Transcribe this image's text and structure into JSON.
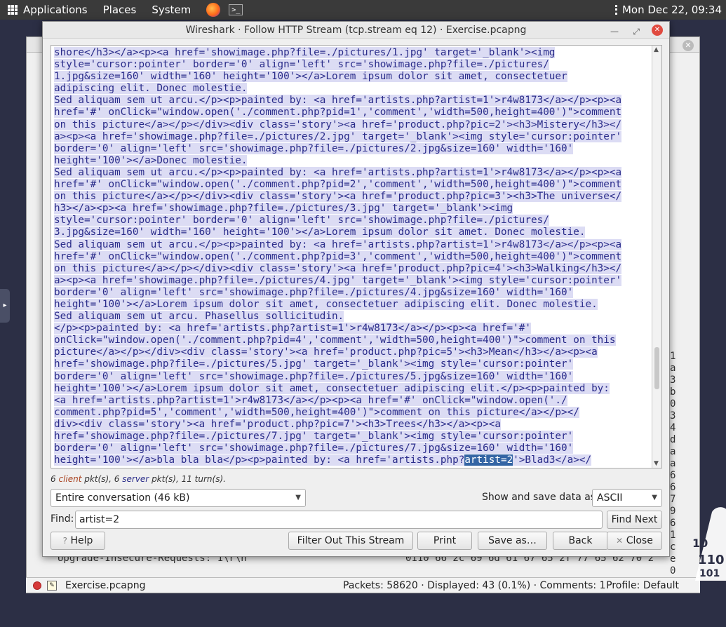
{
  "panel": {
    "applications": "Applications",
    "places": "Places",
    "system": "System",
    "clock": "Mon Dec 22, 09:34"
  },
  "main": {
    "file": "Exercise.pcapng",
    "packets": "Packets: 58620 · Displayed: 43 (0.1%) · Comments: 1",
    "profile": "Profile: Default",
    "bg_request": "Upgrade-Insecure-Requests: 1\\r\\n",
    "bg_bytes": "0110   66 2c 69 6d 61 67 65 2f   77 65 62 70 2"
  },
  "dialog": {
    "title": "Wireshark · Follow HTTP Stream (tcp.stream eq 12) · Exercise.pcapng",
    "stream_lines": [
      "shore</h3></a><p><a href='showimage.php?file=./pictures/1.jpg' target='_blank'><img",
      "style='cursor:pointer' border='0' align='left' src='showimage.php?file=./pictures/",
      "1.jpg&size=160' width='160' height='100'></a>Lorem ipsum dolor sit amet, consectetuer",
      "adipiscing elit. Donec molestie.",
      "Sed aliquam sem ut arcu.</p><p>painted by: <a href='artists.php?artist=1'>r4w8173</a></p><p><a",
      "href='#' onClick=\"window.open('./comment.php?pid=1','comment','width=500,height=400')\">comment",
      "on this picture</a></p></div><div class='story'><a href='product.php?pic=2'><h3>Mistery</h3></",
      "a><p><a href='showimage.php?file=./pictures/2.jpg' target='_blank'><img style='cursor:pointer'",
      "border='0' align='left' src='showimage.php?file=./pictures/2.jpg&size=160' width='160'",
      "height='100'></a>Donec molestie.",
      "Sed aliquam sem ut arcu.</p><p>painted by: <a href='artists.php?artist=1'>r4w8173</a></p><p><a",
      "href='#' onClick=\"window.open('./comment.php?pid=2','comment','width=500,height=400')\">comment",
      "on this picture</a></p></div><div class='story'><a href='product.php?pic=3'><h3>The universe</",
      "h3></a><p><a href='showimage.php?file=./pictures/3.jpg' target='_blank'><img",
      "style='cursor:pointer' border='0' align='left' src='showimage.php?file=./pictures/",
      "3.jpg&size=160' width='160' height='100'></a>Lorem ipsum dolor sit amet. Donec molestie.",
      "Sed aliquam sem ut arcu.</p><p>painted by: <a href='artists.php?artist=1'>r4w8173</a></p><p><a",
      "href='#' onClick=\"window.open('./comment.php?pid=3','comment','width=500,height=400')\">comment",
      "on this picture</a></p></div><div class='story'><a href='product.php?pic=4'><h3>Walking</h3></",
      "a><p><a href='showimage.php?file=./pictures/4.jpg' target='_blank'><img style='cursor:pointer'",
      "border='0' align='left' src='showimage.php?file=./pictures/4.jpg&size=160' width='160'",
      "height='100'></a>Lorem ipsum dolor sit amet, consectetuer adipiscing elit. Donec molestie.",
      "Sed aliquam sem ut arcu. Phasellus sollicitudin.",
      "</p><p>painted by: <a href='artists.php?artist=1'>r4w8173</a></p><p><a href='#'",
      "onClick=\"window.open('./comment.php?pid=4','comment','width=500,height=400')\">comment on this",
      "picture</a></p></div><div class='story'><a href='product.php?pic=5'><h3>Mean</h3></a><p><a",
      "href='showimage.php?file=./pictures/5.jpg' target='_blank'><img style='cursor:pointer'",
      "border='0' align='left' src='showimage.php?file=./pictures/5.jpg&size=160' width='160'",
      "height='100'></a>Lorem ipsum dolor sit amet, consectetuer adipiscing elit.</p><p>painted by:",
      "<a href='artists.php?artist=1'>r4w8173</a></p><p><a href='#' onClick=\"window.open('./",
      "comment.php?pid=5','comment','width=500,height=400')\">comment on this picture</a></p></",
      "div><div class='story'><a href='product.php?pic=7'><h3>Trees</h3></a><p><a",
      "href='showimage.php?file=./pictures/7.jpg' target='_blank'><img style='cursor:pointer'",
      "border='0' align='left' src='showimage.php?file=./pictures/7.jpg&size=160' width='160'"
    ],
    "last_line_before": "height='100'></a>bla bla bla</p><p>painted by: <a href='artists.php?",
    "last_line_match": "artist=2",
    "last_line_after": "'>Blad3</a></",
    "summary_client_count": "6",
    "summary_client": "client",
    "summary_mid": " pkt(s), ",
    "summary_server_count": "6",
    "summary_server": "server",
    "summary_end": " pkt(s), 11 turn(s).",
    "conversation": "Entire conversation (46 kB)",
    "show_label": "Show and save data as",
    "format": "ASCII",
    "find_label": "Find:",
    "find_value": "artist=2",
    "buttons": {
      "find_next": "Find Next",
      "help": "Help",
      "filter_out": "Filter Out This Stream",
      "print": "Print",
      "save_as": "Save as…",
      "back": "Back",
      "close": "Close"
    }
  }
}
